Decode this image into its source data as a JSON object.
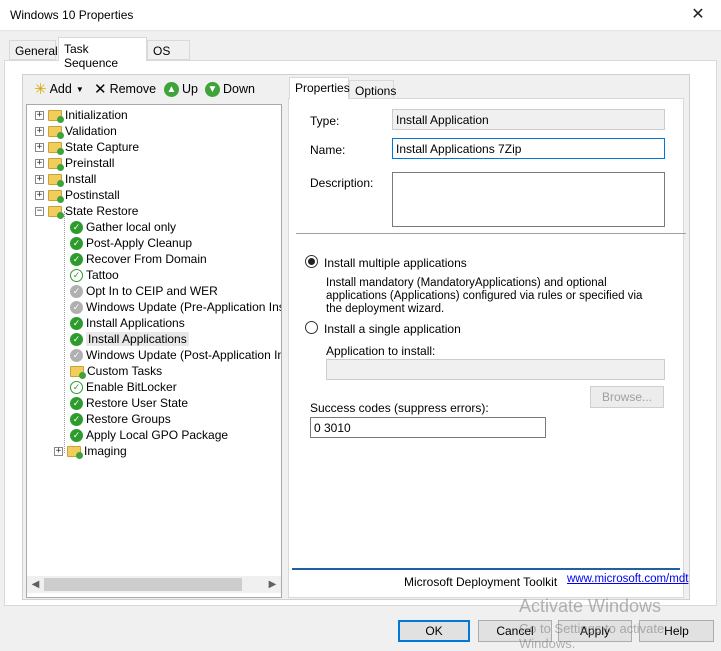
{
  "window": {
    "title": "Windows 10 Properties",
    "close_glyph": "✕"
  },
  "outer_tabs": [
    {
      "label": "General"
    },
    {
      "label": "Task Sequence"
    },
    {
      "label": "OS Info"
    }
  ],
  "toolbar": {
    "add": "Add",
    "remove": "Remove",
    "up": "Up",
    "down": "Down"
  },
  "tree": {
    "groups": [
      "Initialization",
      "Validation",
      "State Capture",
      "Preinstall",
      "Install",
      "Postinstall",
      "State Restore"
    ],
    "children": [
      {
        "label": "Gather local only",
        "icon": "green-check-icon"
      },
      {
        "label": "Post-Apply Cleanup",
        "icon": "green-check-icon"
      },
      {
        "label": "Recover From Domain",
        "icon": "green-check-icon"
      },
      {
        "label": "Tattoo",
        "icon": "outline-check-icon"
      },
      {
        "label": "Opt In to CEIP and WER",
        "icon": "grey-check-icon"
      },
      {
        "label": "Windows Update (Pre-Application Installa",
        "icon": "grey-check-icon"
      },
      {
        "label": "Install Applications",
        "icon": "green-check-icon"
      },
      {
        "label": "Install Applications",
        "icon": "green-check-icon"
      },
      {
        "label": "Windows Update (Post-Application Installa",
        "icon": "grey-check-icon"
      },
      {
        "label": "Custom Tasks",
        "icon": "folder-icon"
      },
      {
        "label": "Enable BitLocker",
        "icon": "outline-check-icon"
      },
      {
        "label": "Restore User State",
        "icon": "green-check-icon"
      },
      {
        "label": "Restore Groups",
        "icon": "green-check-icon"
      },
      {
        "label": "Apply Local GPO Package",
        "icon": "green-check-icon"
      },
      {
        "label": "Imaging",
        "icon": "folder-icon"
      }
    ]
  },
  "right_tabs": [
    {
      "label": "Properties"
    },
    {
      "label": "Options"
    }
  ],
  "properties": {
    "type_label": "Type:",
    "type_value": "Install Application",
    "name_label": "Name:",
    "name_value": "Install Applications 7Zip",
    "description_label": "Description:",
    "description_value": "",
    "radio_multiple": "Install multiple applications",
    "radio_multiple_desc": "Install mandatory (MandatoryApplications) and optional applications (Applications) configured via rules or specified via the deployment wizard.",
    "radio_single": "Install a single application",
    "app_to_install_label": "Application to install:",
    "app_to_install_value": "",
    "browse": "Browse...",
    "success_codes_label": "Success codes (suppress errors):",
    "success_codes_value": "0 3010",
    "footer_text": "Microsoft Deployment Toolkit",
    "footer_link": "www.microsoft.com/mdt"
  },
  "buttons": {
    "ok": "OK",
    "cancel": "Cancel",
    "apply": "Apply",
    "help": "Help"
  },
  "watermark": {
    "line1": "Activate Windows",
    "line2": "Go to Settings to activate Windows."
  }
}
